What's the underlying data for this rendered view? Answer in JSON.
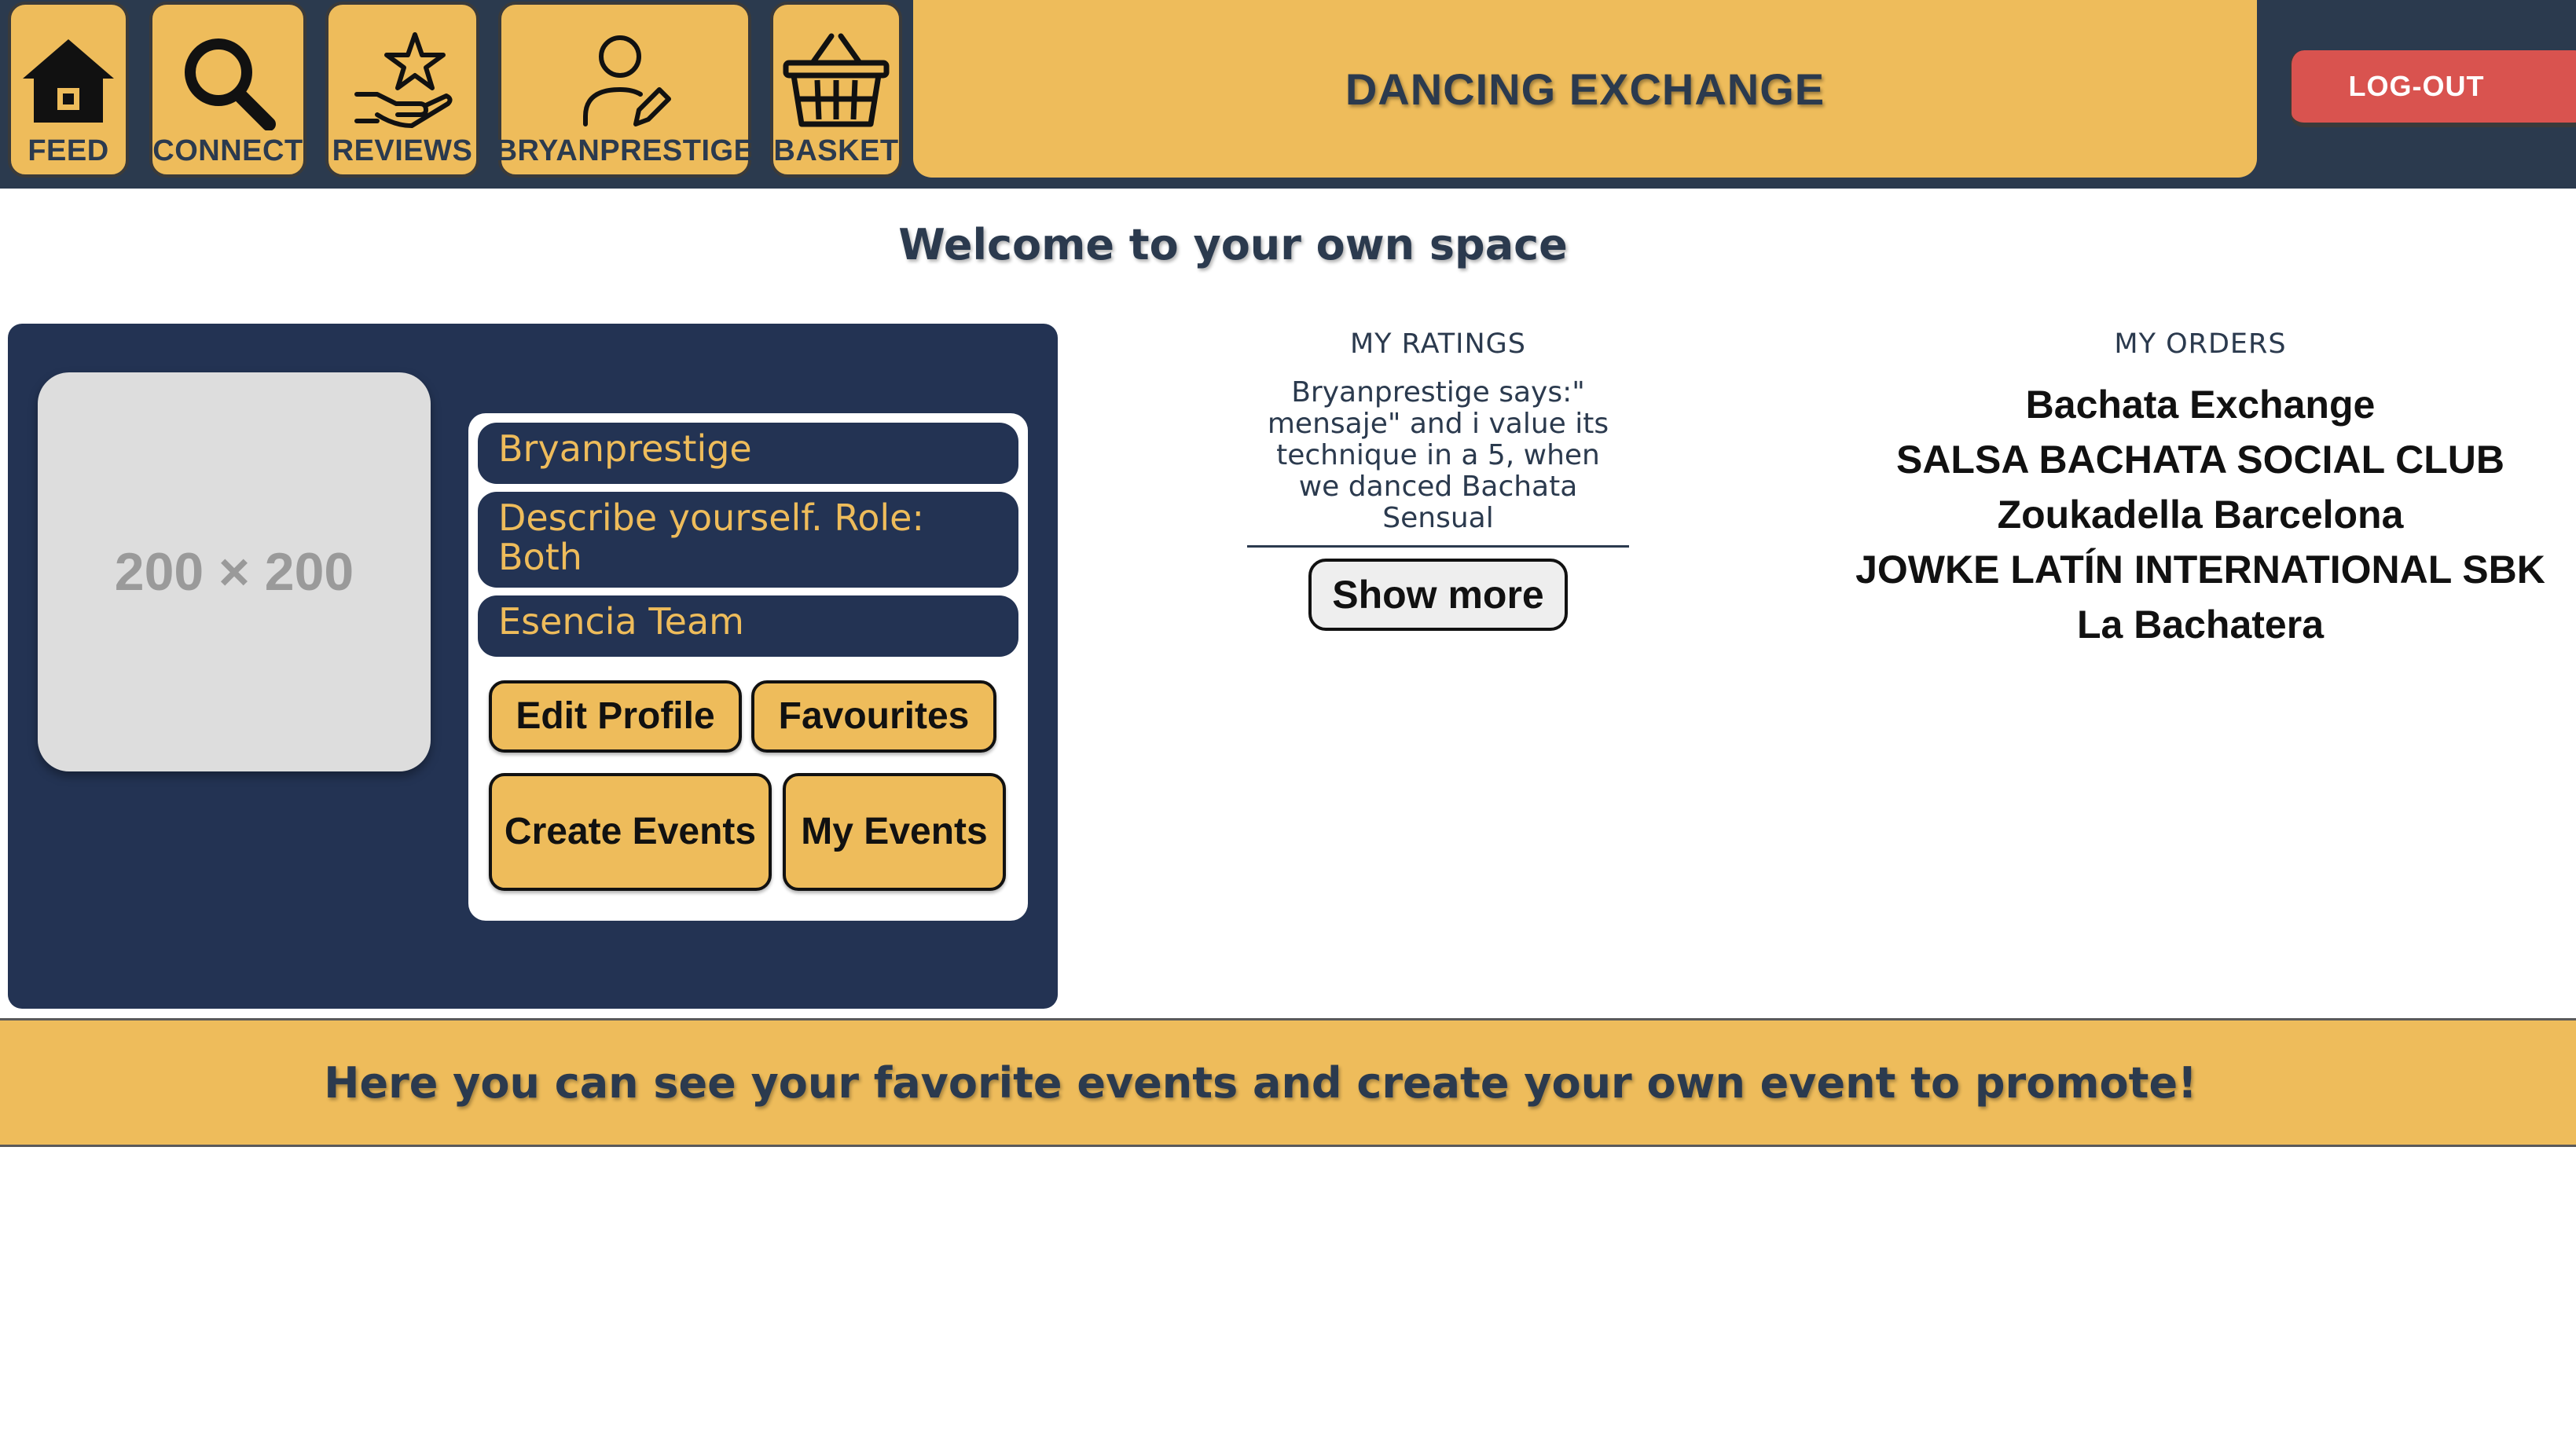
{
  "colors": {
    "navbar_bg": "#2b3a4e",
    "accent_yellow": "#eebc5b",
    "card_navy": "#233353",
    "logout_red": "#d9534f",
    "text_dark": "#2b3a4e"
  },
  "nav": {
    "items": [
      {
        "label": "FEED",
        "icon": "home-icon"
      },
      {
        "label": "CONNECT",
        "icon": "search-icon"
      },
      {
        "label": "REVIEWS",
        "icon": "hand-star-icon"
      },
      {
        "label": "BRYANPRESTIGE",
        "icon": "user-edit-icon"
      },
      {
        "label": "BASKET",
        "icon": "basket-icon"
      }
    ],
    "brand": "DANCING EXCHANGE",
    "logout": "LOG-OUT"
  },
  "welcome": "Welcome to your own space",
  "profile": {
    "avatar_placeholder": "200 × 200",
    "username": "Bryanprestige",
    "description": "Describe yourself. Role: Both",
    "team": "Esencia Team",
    "buttons": {
      "edit": "Edit Profile",
      "favourites": "Favourites",
      "create": "Create Events",
      "my_events": "My Events"
    }
  },
  "ratings": {
    "title": "MY RATINGS",
    "text": "Bryanprestige says:\" mensaje\" and i value its technique in a 5, when we danced Bachata Sensual",
    "show_more": "Show more"
  },
  "orders": {
    "title": "MY ORDERS",
    "items": [
      "Bachata Exchange",
      "SALSA BACHATA SOCIAL CLUB",
      "Zoukadella Barcelona",
      "JOWKE LATÍN INTERNATIONAL SBK",
      "La Bachatera"
    ]
  },
  "banner": "Here you can see your favorite events and create your own event to promote!"
}
